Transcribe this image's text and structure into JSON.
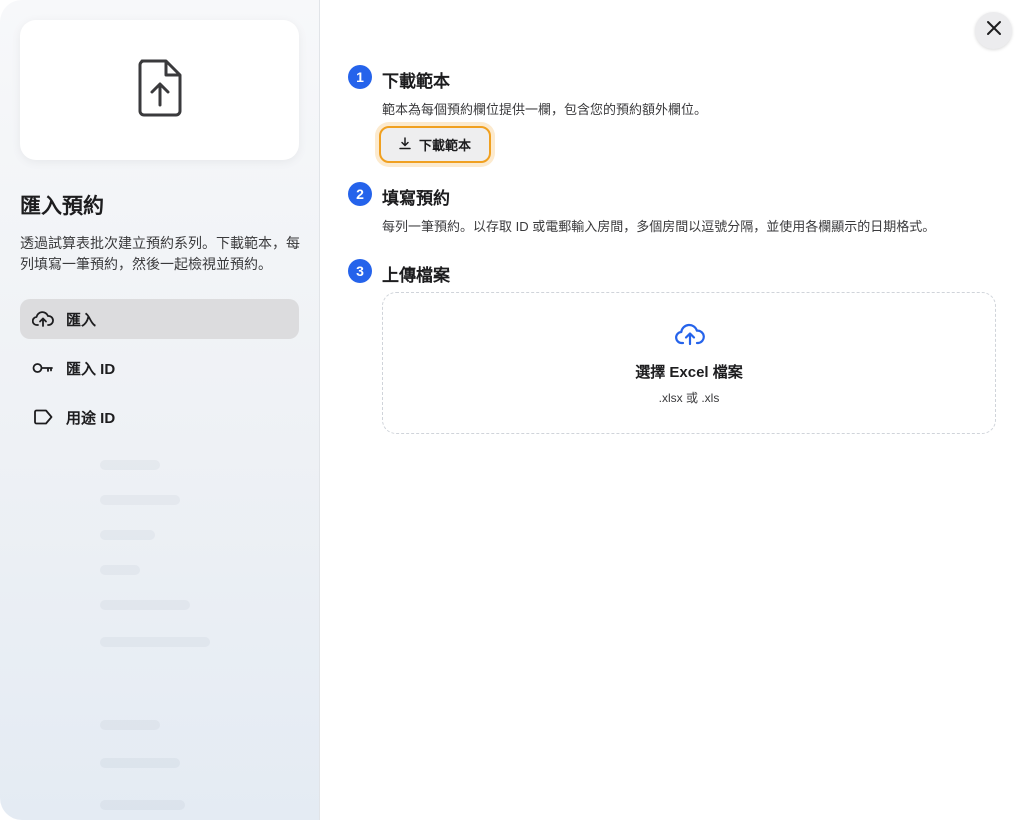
{
  "sidebar": {
    "title": "匯入預約",
    "description": "透過試算表批次建立預約系列。下載範本，每列填寫一筆預約，然後一起檢視並預約。",
    "items": [
      {
        "label": "匯入",
        "icon": "cloud-upload-icon",
        "active": true
      },
      {
        "label": "匯入 ID",
        "icon": "key-icon",
        "active": false
      },
      {
        "label": "用途 ID",
        "icon": "tag-icon",
        "active": false
      }
    ]
  },
  "steps": [
    {
      "number": "1",
      "title": "下載範本",
      "description": "範本為每個預約欄位提供一欄，包含您的預約額外欄位。"
    },
    {
      "number": "2",
      "title": "填寫預約",
      "description": "每列一筆預約。以存取 ID 或電郵輸入房間，多個房間以逗號分隔，並使用各欄顯示的日期格式。"
    },
    {
      "number": "3",
      "title": "上傳檔案",
      "description": ""
    }
  ],
  "download_button": {
    "label": "下載範本",
    "icon": "download-icon"
  },
  "dropzone": {
    "title": "選擇 Excel 檔案",
    "subtitle": ".xlsx 或 .xls",
    "icon": "cloud-upload-icon"
  },
  "close": {
    "icon": "close-icon"
  },
  "colors": {
    "accent": "#2563eb",
    "highlight": "#f0a020"
  }
}
